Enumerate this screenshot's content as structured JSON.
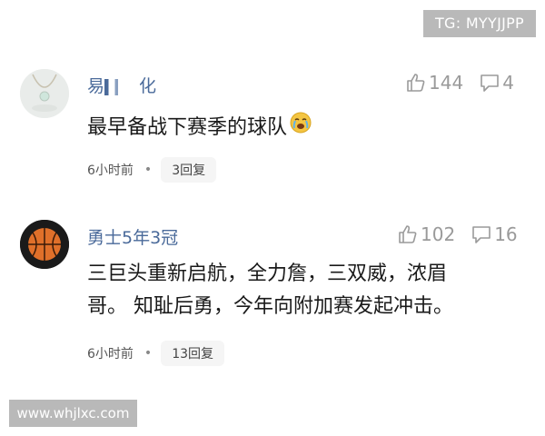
{
  "watermark_tg": "TG: MYYJJPP",
  "watermark_url": "www.whjlxc.com",
  "comments": [
    {
      "username": "易",
      "username_tail": "化",
      "likes": "144",
      "replies_count": "4",
      "text_lines": [
        "最早备战下赛季的球队"
      ],
      "emoji": "crying-face-icon",
      "time": "6小时前",
      "separator": "•",
      "reply_link": "3回复"
    },
    {
      "username": "勇士5年3冠",
      "likes": "102",
      "replies_count": "16",
      "text_lines": [
        "三巨头重新启航，全力詹，三双威，浓眉",
        "哥。 知耻后勇，今年向附加赛发起冲击。"
      ],
      "time": "6小时前",
      "separator": "•",
      "reply_link": "13回复"
    }
  ],
  "colors": {
    "username": "#4a6a9a",
    "muted": "#9a9a9a",
    "pill_bg": "#f5f5f5",
    "watermark_bg": "#b9b9b9"
  }
}
